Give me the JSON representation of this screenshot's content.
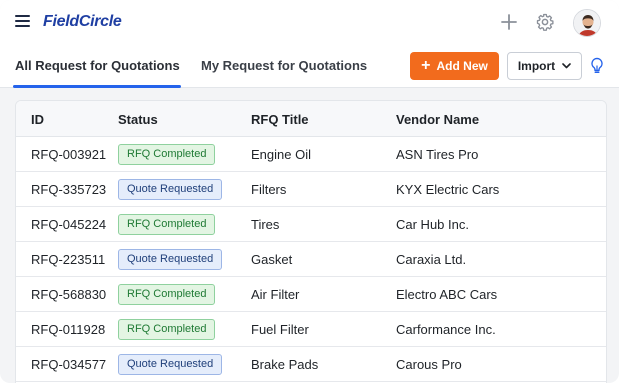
{
  "app": {
    "logo_text": "FieldCircle",
    "brand_color": "#1f3fa3",
    "icons": [
      "hamburger-menu-icon",
      "plus-icon",
      "gear-icon",
      "user-avatar",
      "lightbulb-icon",
      "chevron-down-icon"
    ]
  },
  "tabs": [
    {
      "label": "All Request for Quotations",
      "active": true
    },
    {
      "label": "My Request for Quotations",
      "active": false
    }
  ],
  "toolbar": {
    "add_label": "Add New",
    "add_color": "#f26b1d",
    "import_label": "Import"
  },
  "table": {
    "columns": [
      "ID",
      "Status",
      "RFQ Title",
      "Vendor Name"
    ],
    "rows": [
      {
        "id": "RFQ-003921",
        "status": "RFQ Completed",
        "status_type": "completed",
        "title": "Engine Oil",
        "vendor": "ASN Tires Pro"
      },
      {
        "id": "RFQ-335723",
        "status": "Quote Requested",
        "status_type": "requested",
        "title": "Filters",
        "vendor": "KYX Electric Cars"
      },
      {
        "id": "RFQ-045224",
        "status": "RFQ Completed",
        "status_type": "completed",
        "title": "Tires",
        "vendor": "Car Hub Inc."
      },
      {
        "id": "RFQ-223511",
        "status": "Quote Requested",
        "status_type": "requested",
        "title": "Gasket",
        "vendor": "Caraxia Ltd."
      },
      {
        "id": "RFQ-568830",
        "status": "RFQ Completed",
        "status_type": "completed",
        "title": "Air Filter",
        "vendor": "Electro ABC Cars"
      },
      {
        "id": "RFQ-011928",
        "status": "RFQ Completed",
        "status_type": "completed",
        "title": "Fuel Filter",
        "vendor": "Carformance Inc."
      },
      {
        "id": "RFQ-034577",
        "status": "Quote Requested",
        "status_type": "requested",
        "title": "Brake Pads",
        "vendor": "Carous Pro"
      }
    ]
  },
  "status_colors": {
    "completed": "#1f7a34",
    "requested": "#1f3f7a"
  }
}
